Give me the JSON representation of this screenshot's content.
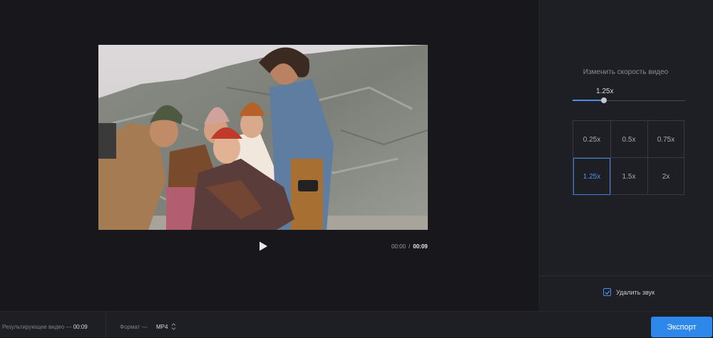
{
  "corner_mark": "□",
  "player": {
    "current_time": "00:00",
    "separator": "/",
    "total_time": "00:09"
  },
  "speed_panel": {
    "title": "Изменить скорость видео",
    "slider_value": "1.25x",
    "slider_level": 0.28,
    "options": [
      "0.25x",
      "0.5x",
      "0.75x",
      "1.25x",
      "1.5x",
      "2x"
    ],
    "selected": "1.25x"
  },
  "mute": {
    "label": "Удалить звук",
    "checked": true
  },
  "footer": {
    "result_label": "Результирующее видео —",
    "result_duration": "00:09",
    "format_label": "Формат —",
    "format_value": "MP4",
    "export_label": "Экспорт"
  },
  "colors": {
    "accent": "#2e88ec",
    "background": "#17171c",
    "panel": "#1e1f24"
  },
  "icons": {
    "play": "play-icon",
    "check": "check-icon",
    "format_toggle": "up-down-arrows-icon"
  }
}
